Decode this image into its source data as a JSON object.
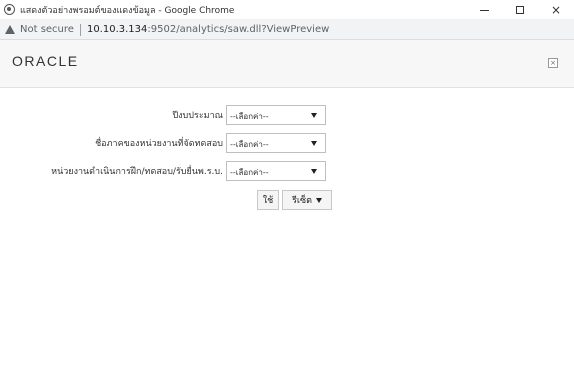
{
  "window": {
    "title": "แสดงตัวอย่างพรอมต์ของแดงข้อมูล - Google Chrome",
    "controls": {
      "minimize": "—",
      "maximize": "☐",
      "close": "×"
    }
  },
  "address_bar": {
    "security_label": "Not secure",
    "host": "10.10.3.134",
    "path": ":9502/analytics/saw.dll?ViewPreview"
  },
  "header": {
    "logo_text": "ORACLE",
    "close_icon_glyph": "×"
  },
  "prompts": [
    {
      "label": "ปีงบประมาณ",
      "value": "--เลือกค่า--"
    },
    {
      "label": "ชื่อภาคของหน่วยงานที่จัดทดสอบ",
      "value": "--เลือกค่า--"
    },
    {
      "label": "หน่วยงานดำเนินการฝึก/ทดสอบ/รับยื่นพ.ร.บ.",
      "value": "--เลือกค่า--"
    }
  ],
  "buttons": {
    "apply_label": "ใช้",
    "reset_label": "รีเซ็ต"
  }
}
